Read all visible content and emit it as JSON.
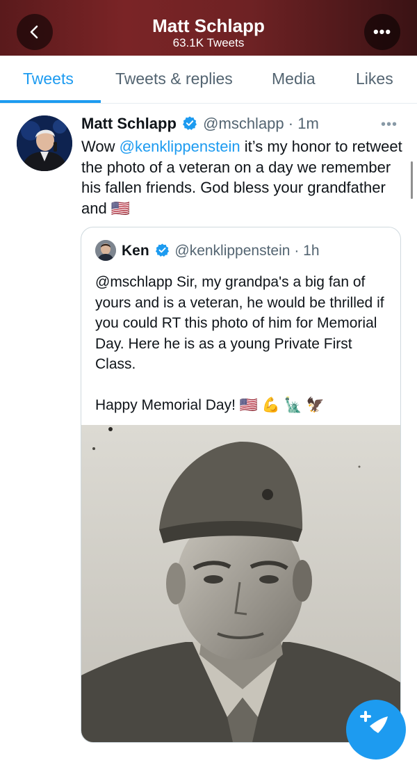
{
  "header": {
    "name": "Matt Schlapp",
    "tweet_count": "63.1K Tweets"
  },
  "tabs": [
    {
      "label": "Tweets",
      "active": true
    },
    {
      "label": "Tweets & replies",
      "active": false
    },
    {
      "label": "Media",
      "active": false
    },
    {
      "label": "Likes",
      "active": false
    }
  ],
  "tweet": {
    "name": "Matt Schlapp",
    "handle": "@mschlapp",
    "time": "· 1m",
    "text_prefix": "Wow ",
    "mention": "@kenklippenstein",
    "text_rest": " it’s my honor to retweet the photo of a veteran on a day we remember his fallen friends. God bless your grandfather and",
    "emoji": "🇺🇸"
  },
  "quote": {
    "name": "Ken",
    "handle": "@kenklippenstein",
    "time": "· 1h",
    "text": "@mschlapp Sir, my grandpa's a big fan of yours and is a veteran, he would be thrilled if you could RT this photo of him for Memorial Day. Here he is as a young Private First Class.",
    "text2": "Happy Memorial Day! 🇺🇸 💪 🗽 🦅"
  },
  "colors": {
    "accent": "#1d9bf0",
    "text": "#0f1419",
    "secondary": "#536471",
    "header_bg": "#6e2224"
  },
  "icons": {
    "back": "chevron-left-icon",
    "more": "more-icon",
    "verified": "verified-badge-icon",
    "compose": "compose-tweet-icon"
  }
}
